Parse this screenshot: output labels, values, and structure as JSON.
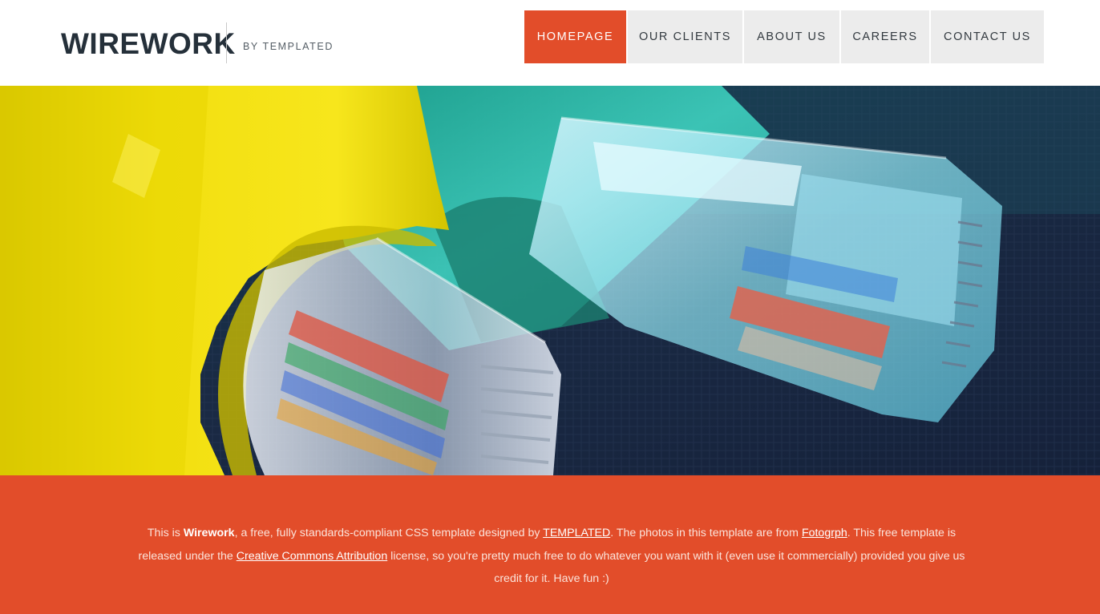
{
  "header": {
    "logo": "WIREWORK",
    "byline": "BY TEMPLATED"
  },
  "nav": {
    "items": [
      {
        "label": "HOMEPAGE",
        "active": true
      },
      {
        "label": "OUR CLIENTS",
        "active": false
      },
      {
        "label": "ABOUT US",
        "active": false
      },
      {
        "label": "CAREERS",
        "active": false
      },
      {
        "label": "CONTACT US",
        "active": false
      }
    ]
  },
  "banner": {
    "image": "ethernet-cables-photo"
  },
  "footer": {
    "t1": "This is ",
    "brand": "Wirework",
    "t2": ", a free, fully standards-compliant CSS template designed by ",
    "link_templated": "TEMPLATED",
    "t3": ". The photos in this template are from ",
    "link_fotogrph": "Fotogrph",
    "t4": ". This free template is released under the ",
    "link_cc": "Creative Commons Attribution",
    "t5": " license, so you're pretty much free to do whatever you want with it (even use it commercially) provided you give us credit for it. Have fun :)"
  },
  "colors": {
    "accent": "#e24d2a",
    "nav_bg": "#ececec",
    "logo": "#25303a"
  }
}
